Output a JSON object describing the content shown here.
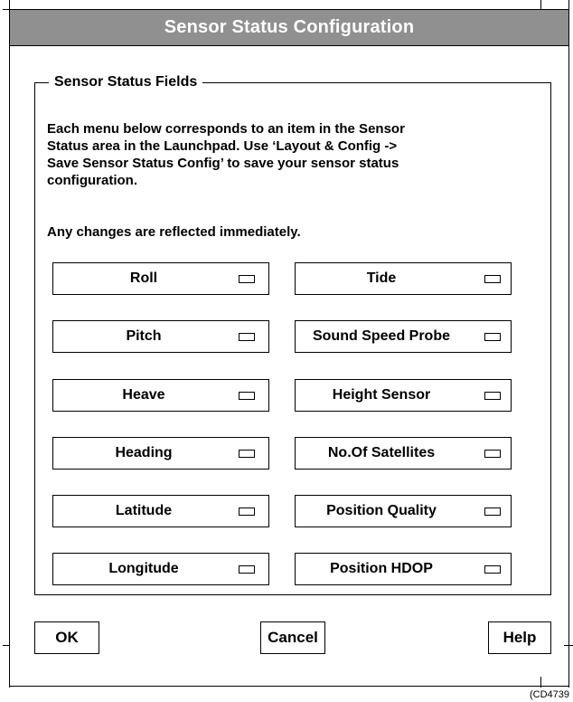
{
  "window": {
    "title": "Sensor Status Configuration"
  },
  "group": {
    "title": "Sensor Status Fields",
    "description_lines": [
      "Each menu below corresponds to an item in the Sensor",
      "Status area in the Launchpad. Use ‘Layout & Config ->",
      "Save Sensor Status Config’ to save your sensor status",
      "configuration."
    ],
    "note": "Any changes are reflected immediately."
  },
  "sensors": {
    "left": [
      "Roll",
      "Pitch",
      "Heave",
      "Heading",
      "Latitude",
      "Longitude"
    ],
    "right": [
      "Tide",
      "Sound Speed Probe",
      "Height Sensor",
      "No.Of Satellites",
      "Position Quality",
      "Position HDOP"
    ]
  },
  "buttons": {
    "ok": "OK",
    "cancel": "Cancel",
    "help": "Help"
  },
  "figure_id": "(CD4739"
}
